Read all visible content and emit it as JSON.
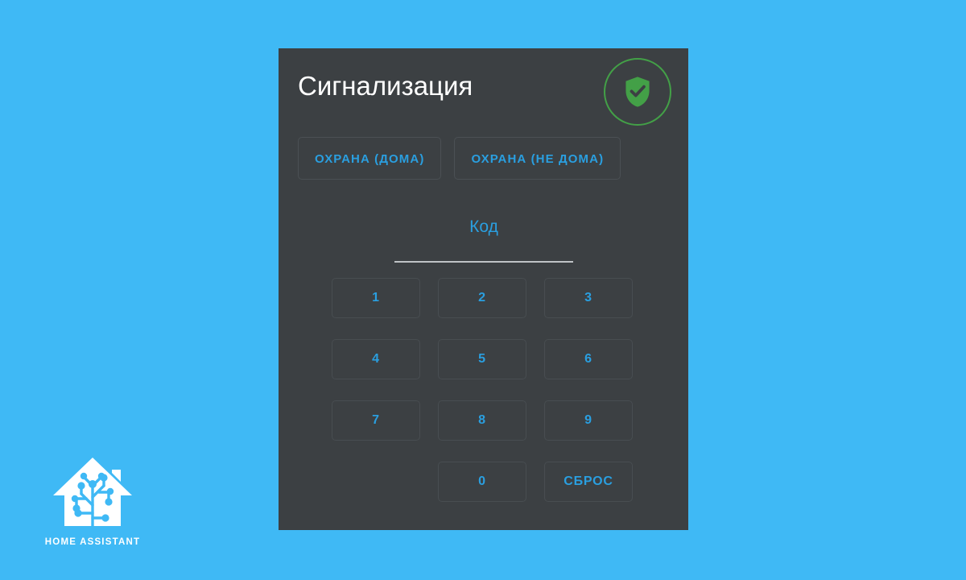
{
  "page": {
    "background_color": "#3fb9f5"
  },
  "card": {
    "background_color": "#3c4043",
    "title": "Сигнализация",
    "state_badge": {
      "icon": "shield-check-icon",
      "color": "#43a047",
      "ring_color": "#43a047"
    },
    "arm_buttons": [
      {
        "label": "ОХРАНА (ДОМА)"
      },
      {
        "label": "ОХРАНА (НЕ ДОМА)"
      }
    ],
    "code_field": {
      "label": "Код",
      "value": "",
      "placeholder": ""
    },
    "keypad": {
      "keys": [
        {
          "label": "1",
          "type": "digit"
        },
        {
          "label": "2",
          "type": "digit"
        },
        {
          "label": "3",
          "type": "digit"
        },
        {
          "label": "4",
          "type": "digit"
        },
        {
          "label": "5",
          "type": "digit"
        },
        {
          "label": "6",
          "type": "digit"
        },
        {
          "label": "7",
          "type": "digit"
        },
        {
          "label": "8",
          "type": "digit"
        },
        {
          "label": "9",
          "type": "digit"
        },
        {
          "label": "",
          "type": "spacer"
        },
        {
          "label": "0",
          "type": "digit"
        },
        {
          "label": "СБРОС",
          "type": "action"
        }
      ]
    },
    "accent_color": "#2a9fe0",
    "title_color": "#ffffff"
  },
  "branding": {
    "logo_icon": "home-assistant-logo-icon",
    "name": "HOME ASSISTANT",
    "color": "#ffffff"
  }
}
